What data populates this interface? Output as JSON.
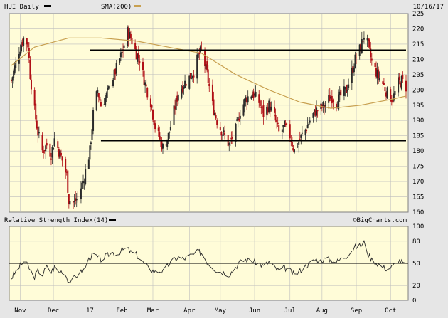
{
  "header": {
    "series_label": "HUI Daily",
    "sma_label": "SMA(200)",
    "date": "10/16/17"
  },
  "rsi_panel": {
    "label": "Relative Strength Index(14)",
    "brand": "©BigCharts.com"
  },
  "colors": {
    "background": "#e6e6e6",
    "plot": "#fffcd8",
    "grid": "#bdbdbd",
    "down_candle": "#b01016",
    "up_candle": "#2a2a2a",
    "sma": "#c8a050",
    "trend_line": "#000000",
    "rsi_line": "#2a2a2a"
  },
  "chart_data": [
    {
      "type": "candlestick",
      "title": "HUI Daily",
      "x_range": [
        "2016-10-24",
        "2017-10-16"
      ],
      "x_tick_labels": [
        {
          "label": "Nov",
          "date": "2016-11-01"
        },
        {
          "label": "Dec",
          "date": "2016-12-01"
        },
        {
          "label": "17",
          "date": "2017-01-03"
        },
        {
          "label": "Feb",
          "date": "2017-02-01"
        },
        {
          "label": "Mar",
          "date": "2017-03-01"
        },
        {
          "label": "Apr",
          "date": "2017-04-03"
        },
        {
          "label": "May",
          "date": "2017-05-01"
        },
        {
          "label": "Jun",
          "date": "2017-06-01"
        },
        {
          "label": "Jul",
          "date": "2017-07-03"
        },
        {
          "label": "Aug",
          "date": "2017-08-01"
        },
        {
          "label": "Sep",
          "date": "2017-09-01"
        },
        {
          "label": "Oct",
          "date": "2017-10-02"
        }
      ],
      "ylim": [
        160,
        225
      ],
      "y_ticks": [
        160,
        165,
        170,
        175,
        180,
        185,
        190,
        195,
        200,
        205,
        210,
        215,
        220,
        225
      ],
      "grid": true,
      "close_path": [
        [
          "2016-10-24",
          203
        ],
        [
          "2016-10-31",
          213
        ],
        [
          "2016-11-04",
          217
        ],
        [
          "2016-11-08",
          215
        ],
        [
          "2016-11-10",
          205
        ],
        [
          "2016-11-14",
          193
        ],
        [
          "2016-11-17",
          186
        ],
        [
          "2016-11-21",
          180
        ],
        [
          "2016-11-25",
          182
        ],
        [
          "2016-11-29",
          179
        ],
        [
          "2016-12-02",
          184
        ],
        [
          "2016-12-06",
          180
        ],
        [
          "2016-12-09",
          177
        ],
        [
          "2016-12-13",
          172
        ],
        [
          "2016-12-15",
          164
        ],
        [
          "2016-12-20",
          163
        ],
        [
          "2016-12-23",
          165
        ],
        [
          "2016-12-28",
          170
        ],
        [
          "2017-01-03",
          180
        ],
        [
          "2017-01-06",
          192
        ],
        [
          "2017-01-10",
          200
        ],
        [
          "2017-01-13",
          195
        ],
        [
          "2017-01-18",
          198
        ],
        [
          "2017-01-23",
          203
        ],
        [
          "2017-01-27",
          207
        ],
        [
          "2017-02-01",
          212
        ],
        [
          "2017-02-06",
          219
        ],
        [
          "2017-02-09",
          217
        ],
        [
          "2017-02-14",
          212
        ],
        [
          "2017-02-17",
          210
        ],
        [
          "2017-02-22",
          202
        ],
        [
          "2017-02-27",
          196
        ],
        [
          "2017-03-03",
          188
        ],
        [
          "2017-03-08",
          183
        ],
        [
          "2017-03-10",
          181
        ],
        [
          "2017-03-15",
          185
        ],
        [
          "2017-03-20",
          193
        ],
        [
          "2017-03-24",
          199
        ],
        [
          "2017-03-29",
          202
        ],
        [
          "2017-04-03",
          204
        ],
        [
          "2017-04-07",
          206
        ],
        [
          "2017-04-11",
          211
        ],
        [
          "2017-04-14",
          213
        ],
        [
          "2017-04-19",
          205
        ],
        [
          "2017-04-24",
          195
        ],
        [
          "2017-04-28",
          190
        ],
        [
          "2017-05-03",
          186
        ],
        [
          "2017-05-09",
          182
        ],
        [
          "2017-05-15",
          187
        ],
        [
          "2017-05-19",
          193
        ],
        [
          "2017-05-24",
          197
        ],
        [
          "2017-05-30",
          199
        ],
        [
          "2017-06-05",
          196
        ],
        [
          "2017-06-09",
          192
        ],
        [
          "2017-06-14",
          195
        ],
        [
          "2017-06-19",
          191
        ],
        [
          "2017-06-23",
          186
        ],
        [
          "2017-06-28",
          188
        ],
        [
          "2017-07-03",
          185
        ],
        [
          "2017-07-07",
          180
        ],
        [
          "2017-07-12",
          184
        ],
        [
          "2017-07-17",
          187
        ],
        [
          "2017-07-21",
          190
        ],
        [
          "2017-07-26",
          193
        ],
        [
          "2017-07-31",
          194
        ],
        [
          "2017-08-04",
          195
        ],
        [
          "2017-08-09",
          198
        ],
        [
          "2017-08-14",
          196
        ],
        [
          "2017-08-18",
          198
        ],
        [
          "2017-08-23",
          200
        ],
        [
          "2017-08-28",
          206
        ],
        [
          "2017-08-31",
          210
        ],
        [
          "2017-09-05",
          214
        ],
        [
          "2017-09-08",
          218
        ],
        [
          "2017-09-12",
          214
        ],
        [
          "2017-09-15",
          209
        ],
        [
          "2017-09-20",
          205
        ],
        [
          "2017-09-25",
          202
        ],
        [
          "2017-09-29",
          199
        ],
        [
          "2017-10-04",
          197
        ],
        [
          "2017-10-09",
          202
        ],
        [
          "2017-10-12",
          203
        ],
        [
          "2017-10-16",
          201
        ]
      ],
      "sma_200": [
        [
          "2016-10-24",
          208
        ],
        [
          "2016-11-14",
          214
        ],
        [
          "2016-12-15",
          217
        ],
        [
          "2017-01-13",
          217
        ],
        [
          "2017-02-14",
          216
        ],
        [
          "2017-03-15",
          214
        ],
        [
          "2017-04-14",
          212
        ],
        [
          "2017-05-15",
          205
        ],
        [
          "2017-06-14",
          200
        ],
        [
          "2017-07-12",
          196
        ],
        [
          "2017-08-09",
          194
        ],
        [
          "2017-09-05",
          195
        ],
        [
          "2017-10-04",
          197
        ],
        [
          "2017-10-16",
          198
        ]
      ],
      "trend_lines": [
        {
          "from": [
            "2017-01-03",
            213
          ],
          "to": [
            "2017-10-16",
            213
          ]
        },
        {
          "from": [
            "2017-01-13",
            183.4
          ],
          "to": [
            "2017-10-16",
            183.4
          ]
        }
      ]
    },
    {
      "type": "line",
      "title": "Relative Strength Index(14)",
      "ylim": [
        0,
        100
      ],
      "y_ticks": [
        0,
        20,
        50,
        80,
        100
      ],
      "reference_line": 50,
      "values": [
        [
          "2016-10-24",
          30
        ],
        [
          "2016-10-31",
          45
        ],
        [
          "2016-11-04",
          52
        ],
        [
          "2016-11-08",
          47
        ],
        [
          "2016-11-10",
          40
        ],
        [
          "2016-11-14",
          32
        ],
        [
          "2016-11-17",
          40
        ],
        [
          "2016-11-21",
          35
        ],
        [
          "2016-11-25",
          45
        ],
        [
          "2016-11-29",
          38
        ],
        [
          "2016-12-02",
          45
        ],
        [
          "2016-12-06",
          38
        ],
        [
          "2016-12-09",
          40
        ],
        [
          "2016-12-13",
          32
        ],
        [
          "2016-12-15",
          25
        ],
        [
          "2016-12-20",
          30
        ],
        [
          "2016-12-23",
          35
        ],
        [
          "2016-12-28",
          40
        ],
        [
          "2017-01-03",
          58
        ],
        [
          "2017-01-06",
          62
        ],
        [
          "2017-01-10",
          58
        ],
        [
          "2017-01-13",
          55
        ],
        [
          "2017-01-18",
          60
        ],
        [
          "2017-01-23",
          65
        ],
        [
          "2017-01-27",
          62
        ],
        [
          "2017-02-01",
          68
        ],
        [
          "2017-02-06",
          70
        ],
        [
          "2017-02-09",
          65
        ],
        [
          "2017-02-14",
          62
        ],
        [
          "2017-02-17",
          56
        ],
        [
          "2017-02-22",
          48
        ],
        [
          "2017-02-27",
          42
        ],
        [
          "2017-03-03",
          38
        ],
        [
          "2017-03-08",
          40
        ],
        [
          "2017-03-10",
          38
        ],
        [
          "2017-03-15",
          48
        ],
        [
          "2017-03-20",
          55
        ],
        [
          "2017-03-24",
          58
        ],
        [
          "2017-03-29",
          56
        ],
        [
          "2017-04-03",
          60
        ],
        [
          "2017-04-07",
          62
        ],
        [
          "2017-04-11",
          66
        ],
        [
          "2017-04-14",
          64
        ],
        [
          "2017-04-19",
          52
        ],
        [
          "2017-04-24",
          45
        ],
        [
          "2017-04-28",
          40
        ],
        [
          "2017-05-03",
          38
        ],
        [
          "2017-05-09",
          35
        ],
        [
          "2017-05-15",
          45
        ],
        [
          "2017-05-19",
          52
        ],
        [
          "2017-05-24",
          55
        ],
        [
          "2017-05-30",
          53
        ],
        [
          "2017-06-05",
          50
        ],
        [
          "2017-06-09",
          46
        ],
        [
          "2017-06-14",
          52
        ],
        [
          "2017-06-19",
          44
        ],
        [
          "2017-06-23",
          40
        ],
        [
          "2017-06-28",
          44
        ],
        [
          "2017-07-03",
          40
        ],
        [
          "2017-07-07",
          34
        ],
        [
          "2017-07-12",
          40
        ],
        [
          "2017-07-17",
          46
        ],
        [
          "2017-07-21",
          50
        ],
        [
          "2017-07-26",
          55
        ],
        [
          "2017-07-31",
          54
        ],
        [
          "2017-08-04",
          56
        ],
        [
          "2017-08-09",
          55
        ],
        [
          "2017-08-14",
          52
        ],
        [
          "2017-08-18",
          56
        ],
        [
          "2017-08-23",
          60
        ],
        [
          "2017-08-28",
          68
        ],
        [
          "2017-08-31",
          72
        ],
        [
          "2017-09-05",
          74
        ],
        [
          "2017-09-08",
          78
        ],
        [
          "2017-09-12",
          62
        ],
        [
          "2017-09-15",
          55
        ],
        [
          "2017-09-20",
          50
        ],
        [
          "2017-09-25",
          45
        ],
        [
          "2017-09-29",
          42
        ],
        [
          "2017-10-04",
          46
        ],
        [
          "2017-10-09",
          54
        ],
        [
          "2017-10-12",
          52
        ],
        [
          "2017-10-16",
          47
        ]
      ]
    }
  ]
}
